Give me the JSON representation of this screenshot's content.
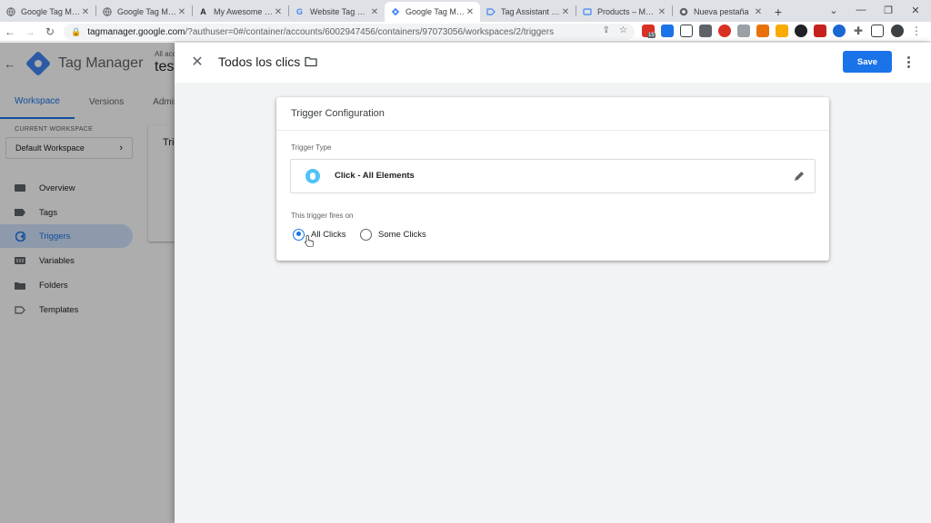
{
  "browser": {
    "tabs": [
      {
        "title": "Google Tag Manager",
        "icon": "globe-icon",
        "active": false
      },
      {
        "title": "Google Tag Manager",
        "icon": "globe-icon",
        "active": false
      },
      {
        "title": "My Awesome Store",
        "icon": "store-icon",
        "active": false
      },
      {
        "title": "Website Tag Manager",
        "icon": "google-icon",
        "active": false
      },
      {
        "title": "Google Tag Manager",
        "icon": "gtm-icon",
        "active": true
      },
      {
        "title": "Tag Assistant [Connected]",
        "icon": "tag-icon",
        "active": false
      },
      {
        "title": "Products – My Awesome Store",
        "icon": "bag-icon",
        "active": false
      },
      {
        "title": "Nueva pestaña",
        "icon": "chrome-icon",
        "active": false
      }
    ],
    "new_tab_label": "+",
    "url_host": "tagmanager.google.com",
    "url_path": "/?authuser=0#/container/accounts/6002947456/containers/97073056/workspaces/2/triggers",
    "extension_badge": "15"
  },
  "gtm": {
    "app_name": "Tag Manager",
    "account_label": "All acc",
    "container_name": "test",
    "nav_tabs": [
      "Workspace",
      "Versions",
      "Admin"
    ],
    "current_workspace_label": "CURRENT WORKSPACE",
    "workspace_name": "Default Workspace",
    "sidebar": [
      {
        "label": "Overview",
        "icon": "overview-icon",
        "active": false
      },
      {
        "label": "Tags",
        "icon": "tag-icon",
        "active": false
      },
      {
        "label": "Triggers",
        "icon": "trigger-icon",
        "active": true
      },
      {
        "label": "Variables",
        "icon": "variables-icon",
        "active": false
      },
      {
        "label": "Folders",
        "icon": "folder-icon",
        "active": false
      },
      {
        "label": "Templates",
        "icon": "template-icon",
        "active": false
      }
    ],
    "card_heading_partial": "Trig"
  },
  "panel": {
    "title": "Todos los clics",
    "save_label": "Save",
    "config_title": "Trigger Configuration",
    "trigger_type_label": "Trigger Type",
    "trigger_type_value": "Click - All Elements",
    "fires_on_label": "This trigger fires on",
    "options": [
      {
        "label": "All Clicks",
        "selected": true
      },
      {
        "label": "Some Clicks",
        "selected": false
      }
    ]
  },
  "colors": {
    "accent": "#1a73e8",
    "trigger_icon": "#4fc3f7",
    "active_nav_bg": "#d2e3fc"
  }
}
